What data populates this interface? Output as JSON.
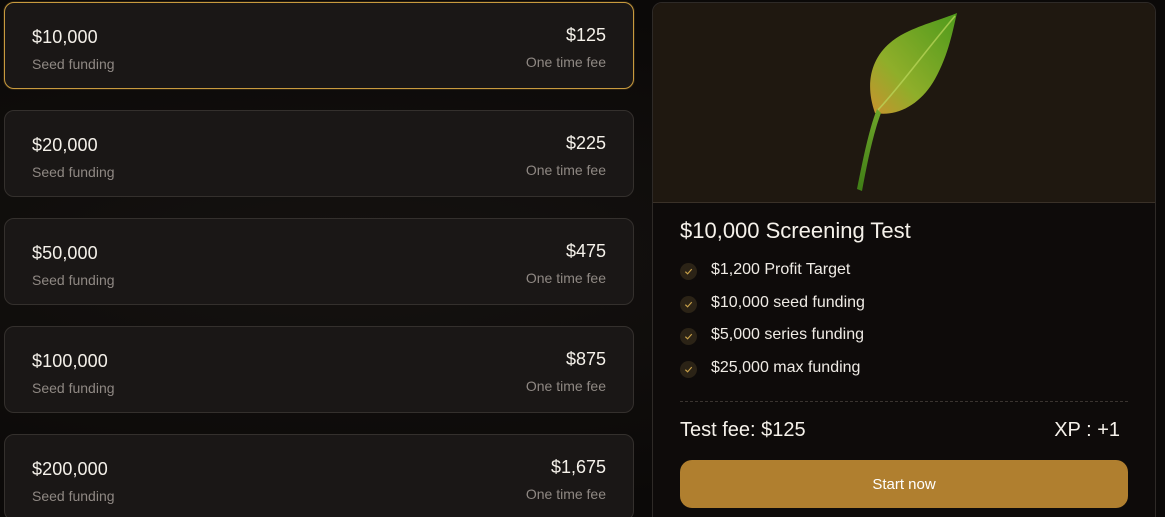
{
  "plans": [
    {
      "amount": "$10,000",
      "subtitle": "Seed funding",
      "price": "$125",
      "fee_label": "One time fee",
      "selected": true
    },
    {
      "amount": "$20,000",
      "subtitle": "Seed funding",
      "price": "$225",
      "fee_label": "One time fee",
      "selected": false
    },
    {
      "amount": "$50,000",
      "subtitle": "Seed funding",
      "price": "$475",
      "fee_label": "One time fee",
      "selected": false
    },
    {
      "amount": "$100,000",
      "subtitle": "Seed funding",
      "price": "$875",
      "fee_label": "One time fee",
      "selected": false
    },
    {
      "amount": "$200,000",
      "subtitle": "Seed funding",
      "price": "$1,675",
      "fee_label": "One time fee",
      "selected": false
    }
  ],
  "detail": {
    "hero_icon": "leaf-icon",
    "title": "$10,000 Screening Test",
    "features": [
      {
        "icon": "check-icon",
        "text": "$1,200 Profit Target"
      },
      {
        "icon": "check-icon",
        "text": "$10,000 seed funding"
      },
      {
        "icon": "check-icon",
        "text": "$5,000 series funding"
      },
      {
        "icon": "check-icon",
        "text": "$25,000 max funding"
      }
    ],
    "test_fee": "Test fee: $125",
    "xp": "XP : +1",
    "cta_label": "Start now"
  },
  "colors": {
    "accent": "#b07f2f",
    "selected_border": "#c89a3e",
    "card_bg": "#1a1716",
    "muted_text": "#8f8883"
  }
}
